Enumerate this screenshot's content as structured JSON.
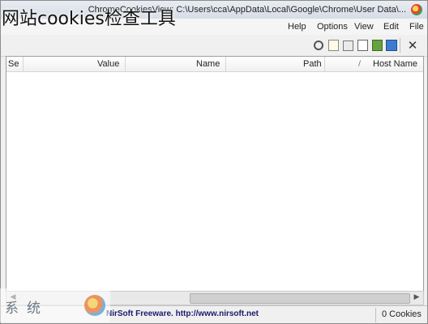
{
  "window": {
    "title": "ChromeCookiesView: C:\\Users\\cca\\AppData\\Local\\Google\\Chrome\\User Data\\...",
    "app_icon": "chromecookiesview-app-icon"
  },
  "menu": {
    "items": [
      "File",
      "Edit",
      "View",
      "Options",
      "Help"
    ]
  },
  "toolbar": {
    "icons": [
      "close-icon",
      "save-icon",
      "html-report-icon",
      "copy-icon",
      "properties-icon",
      "edit-icon",
      "find-icon"
    ]
  },
  "list": {
    "columns": [
      "Host Name",
      "Path",
      "Name",
      "Value",
      "Se"
    ],
    "sort_indicator": "/",
    "rows": []
  },
  "status": {
    "count": "0 Cookies",
    "credit": "NirSoft Freeware.  http://www.nirsoft.net"
  },
  "overlay": {
    "caption": "网站cookies检查工具"
  },
  "watermark": {
    "text": "系统",
    "logo_icon": "watermark-logo-icon"
  }
}
